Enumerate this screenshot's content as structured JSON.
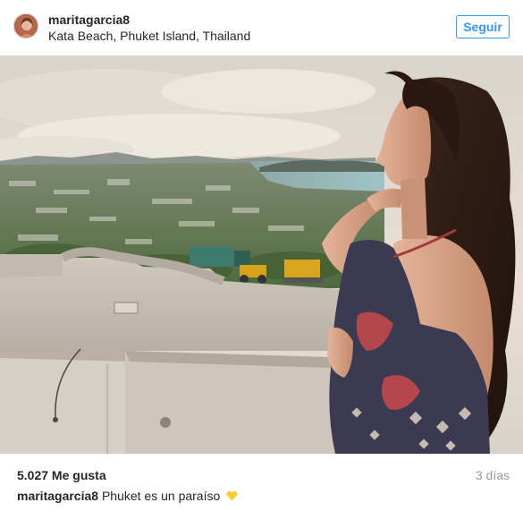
{
  "header": {
    "username": "maritagarcia8",
    "location": "Kata Beach, Phuket Island, Thailand",
    "follow_label": "Seguir"
  },
  "photo": {
    "subject": "woman-on-viewpoint-overlooking-bay"
  },
  "footer": {
    "likes": "5.027 Me gusta",
    "time": "3 días",
    "caption_user": "maritagarcia8",
    "caption_text": "Phuket es un paraíso",
    "caption_emoji_icon": "yellow-heart-icon"
  },
  "colors": {
    "follow_blue": "#3897f0",
    "text": "#262626",
    "muted": "#999999",
    "heart_yellow": "#ffcc33"
  }
}
